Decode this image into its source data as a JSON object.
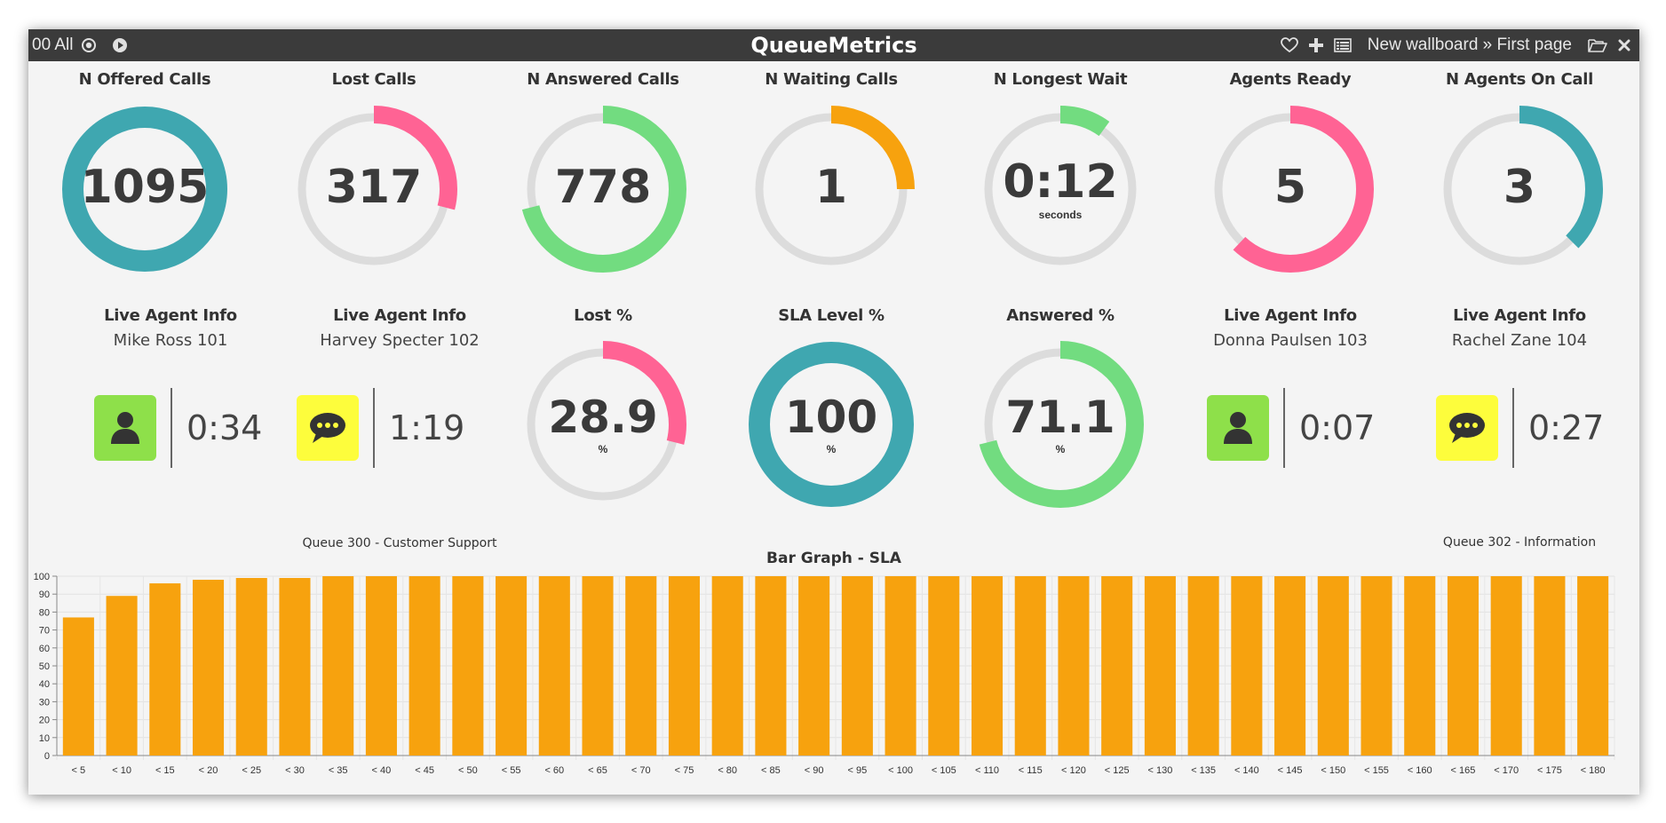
{
  "titlebar": {
    "left_label": "00 All",
    "title": "QueueMetrics",
    "breadcrumb": "New wallboard » First page",
    "icons": [
      "record-icon",
      "play-icon",
      "heart-icon",
      "plus-icon",
      "list-icon",
      "folder-icon",
      "close-icon"
    ]
  },
  "colors": {
    "teal": "#3fa7b0",
    "pink": "#ff6394",
    "green": "#72dc80",
    "orange": "#f7a20e",
    "track": "#dcdcdc",
    "agent_green": "#8ee04a",
    "agent_yellow": "#fdfd3c",
    "bar": "#f7a20e"
  },
  "gauges_row1": [
    {
      "title": "N Offered Calls",
      "value": "1095",
      "unit": "",
      "fraction": 1.0,
      "color": "#3fa7b0"
    },
    {
      "title": "Lost Calls",
      "value": "317",
      "unit": "",
      "fraction": 0.29,
      "color": "#ff6394"
    },
    {
      "title": "N Answered Calls",
      "value": "778",
      "unit": "",
      "fraction": 0.71,
      "color": "#72dc80"
    },
    {
      "title": "N Waiting Calls",
      "value": "1",
      "unit": "",
      "fraction": 0.25,
      "color": "#f7a20e"
    },
    {
      "title": "N Longest Wait",
      "value": "0:12",
      "unit": "seconds",
      "fraction": 0.1,
      "color": "#72dc80"
    },
    {
      "title": "Agents Ready",
      "value": "5",
      "unit": "",
      "fraction": 0.62,
      "color": "#ff6394"
    },
    {
      "title": "N Agents On Call",
      "value": "3",
      "unit": "",
      "fraction": 0.375,
      "color": "#3fa7b0"
    }
  ],
  "row2": {
    "agent1": {
      "title": "Live Agent Info",
      "name": "Mike Ross 101",
      "status": "ready",
      "icon": "user-icon",
      "time": "0:34"
    },
    "agent2": {
      "title": "Live Agent Info",
      "name": "Harvey Specter 102",
      "status": "on-call",
      "icon": "chat-icon",
      "time": "1:19",
      "queue": "Queue 300 - Customer Support"
    },
    "lost_pct": {
      "title": "Lost %",
      "value": "28.9",
      "unit": "%",
      "fraction": 0.289,
      "color": "#ff6394"
    },
    "sla_pct": {
      "title": "SLA Level %",
      "value": "100",
      "unit": "%",
      "fraction": 1.0,
      "color": "#3fa7b0"
    },
    "answered_pct": {
      "title": "Answered %",
      "value": "71.1",
      "unit": "%",
      "fraction": 0.711,
      "color": "#72dc80"
    },
    "agent3": {
      "title": "Live Agent Info",
      "name": "Donna Paulsen 103",
      "status": "ready",
      "icon": "user-icon",
      "time": "0:07"
    },
    "agent4": {
      "title": "Live Agent Info",
      "name": "Rachel Zane 104",
      "status": "on-call",
      "icon": "chat-icon",
      "time": "0:27",
      "queue": "Queue 302 - Information"
    }
  },
  "chart_data": {
    "type": "bar",
    "title": "Bar Graph - SLA",
    "xlabel": "",
    "ylabel": "",
    "ylim": [
      0,
      100
    ],
    "yticks": [
      0,
      10,
      20,
      30,
      40,
      50,
      60,
      70,
      80,
      90,
      100
    ],
    "grid": true,
    "categories": [
      "< 5",
      "< 10",
      "< 15",
      "< 20",
      "< 25",
      "< 30",
      "< 35",
      "< 40",
      "< 45",
      "< 50",
      "< 55",
      "< 60",
      "< 65",
      "< 70",
      "< 75",
      "< 80",
      "< 85",
      "< 90",
      "< 95",
      "< 100",
      "< 105",
      "< 110",
      "< 115",
      "< 120",
      "< 125",
      "< 130",
      "< 135",
      "< 140",
      "< 145",
      "< 150",
      "< 155",
      "< 160",
      "< 165",
      "< 170",
      "< 175",
      "< 180"
    ],
    "values": [
      77,
      89,
      96,
      98,
      99,
      99,
      100,
      100,
      100,
      100,
      100,
      100,
      100,
      100,
      100,
      100,
      100,
      100,
      100,
      100,
      100,
      100,
      100,
      100,
      100,
      100,
      100,
      100,
      100,
      100,
      100,
      100,
      100,
      100,
      100,
      100
    ]
  }
}
